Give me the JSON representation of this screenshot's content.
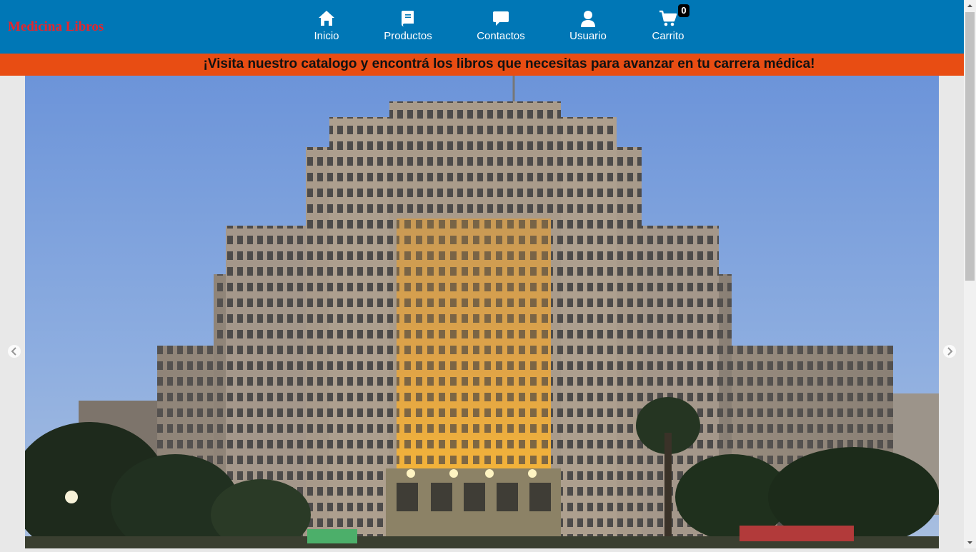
{
  "brand": {
    "name": "Medicina Libros"
  },
  "nav": {
    "items": [
      {
        "label": "Inicio",
        "icon": "home-icon"
      },
      {
        "label": "Productos",
        "icon": "book-icon"
      },
      {
        "label": "Contactos",
        "icon": "chat-icon"
      },
      {
        "label": "Usuario",
        "icon": "user-icon"
      },
      {
        "label": "Carrito",
        "icon": "cart-icon"
      }
    ],
    "cart_count": "0"
  },
  "promo": {
    "text": "¡Visita nuestro catalogo y encontrá los libros que necesitas para avanzar en tu carrera médica!"
  },
  "colors": {
    "navbar": "#0077b6",
    "brand": "#e4262d",
    "promo": "#e84d13"
  }
}
